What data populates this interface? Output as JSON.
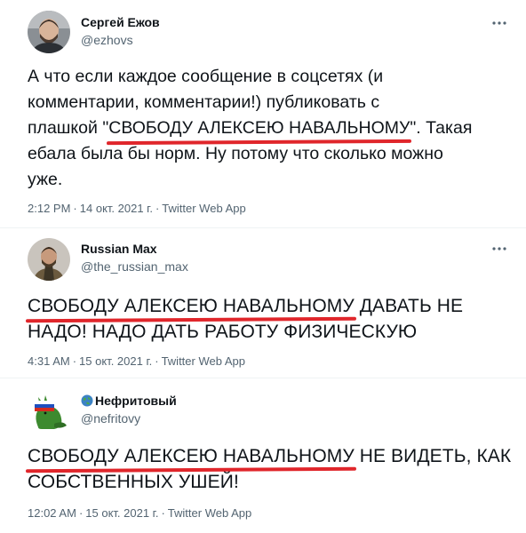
{
  "tweets": [
    {
      "author": {
        "name": "Сергей Ежов",
        "handle": "@ezhovs"
      },
      "body": {
        "l1": "А что если каждое сообщение в соцсетях (и",
        "l2": "комментарии, комментарии!) публиковать с",
        "l3_pre": "плашкой \"",
        "l3_hl": "СВОБОДУ АЛЕКСЕЮ НАВАЛЬНОМУ",
        "l3_post": "\". Такая",
        "l4": "ебала была бы норм. Ну потому что сколько можно",
        "l5": "уже."
      },
      "meta": {
        "time": "2:12 PM",
        "date": "14 окт. 2021 г.",
        "separator": "·",
        "app": "Twitter Web App"
      }
    },
    {
      "author": {
        "name": "Russian Max",
        "handle": "@the_russian_max"
      },
      "body": {
        "l1_hl": "СВОБОДУ АЛЕКСЕЮ НАВАЛЬНОМУ",
        "l1_post": " ДАВАТЬ НЕ",
        "l2": "НАДО! НАДО ДАТЬ РАБОТУ ФИЗИЧЕСКУЮ"
      },
      "meta": {
        "time": "4:31 AM",
        "date": "15 окт. 2021 г.",
        "separator": "·",
        "app": "Twitter Web App"
      }
    },
    {
      "author": {
        "name": "Нефритовый",
        "handle": "@nefritovy",
        "name_emoji": "globe-icon"
      },
      "body": {
        "l1_hl": "СВОБОДУ АЛЕКСЕЮ НАВАЛЬНОМУ",
        "l1_post": " НЕ ВИДЕТЬ, КАК",
        "l2": "СОБСТВЕННЫХ УШЕЙ!"
      },
      "meta": {
        "time": "12:02 AM",
        "date": "15 окт. 2021 г.",
        "separator": "·",
        "app": "Twitter Web App"
      }
    }
  ],
  "colors": {
    "text": "#0f1419",
    "secondary": "#536471",
    "highlight_underline": "#e0262b",
    "divider": "#eff3f4"
  }
}
